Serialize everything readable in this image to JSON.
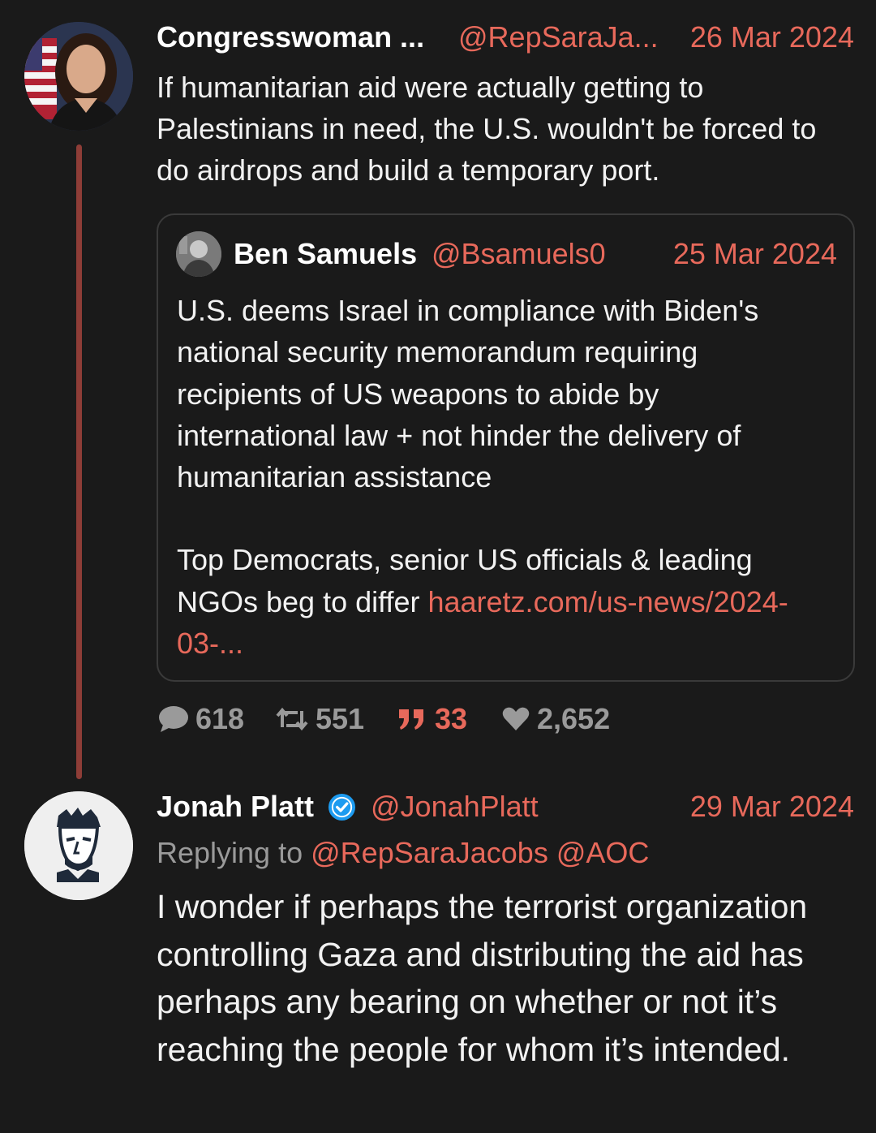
{
  "tweet1": {
    "author_name": "Congresswoman ...",
    "handle": "@RepSaraJa...",
    "date": "26 Mar 2024",
    "text": "If humanitarian aid were actually getting to Palestinians in need, the U.S. wouldn't be forced to do airdrops and build a temporary port.",
    "quote": {
      "author_name": "Ben Samuels",
      "handle": "@Bsamuels0",
      "date": "25 Mar 2024",
      "paragraph1": "U.S. deems Israel in compliance with Biden's national security memorandum requiring recipients of US weapons to abide by international law + not hinder the delivery of humanitarian assistance",
      "paragraph2_text": "Top Democrats, senior US officials & leading NGOs beg to differ ",
      "paragraph2_link": "haaretz.com/us-news/2024-03-..."
    },
    "stats": {
      "replies": "618",
      "retweets": "551",
      "quotes": "33",
      "likes": "2,652"
    }
  },
  "tweet2": {
    "author_name": "Jonah Platt",
    "handle": "@JonahPlatt",
    "date": "29 Mar 2024",
    "replying_to_label": "Replying to",
    "replying_to_handles": "@RepSaraJacobs @AOC",
    "text": "I wonder if perhaps the terrorist organization controlling Gaza and distributing the aid has perhaps any bearing on whether or not it’s reaching the people for whom it’s intended."
  },
  "colors": {
    "background": "#1a1a1a",
    "accent": "#e8695b",
    "thread_line": "#8e3d37",
    "muted": "#9a9a9a",
    "verified": "#1d9bf0"
  },
  "icons": [
    "avatar-photo",
    "reply-bubble-icon",
    "retweet-icon",
    "quote-icon",
    "heart-icon",
    "verified-badge-icon"
  ]
}
